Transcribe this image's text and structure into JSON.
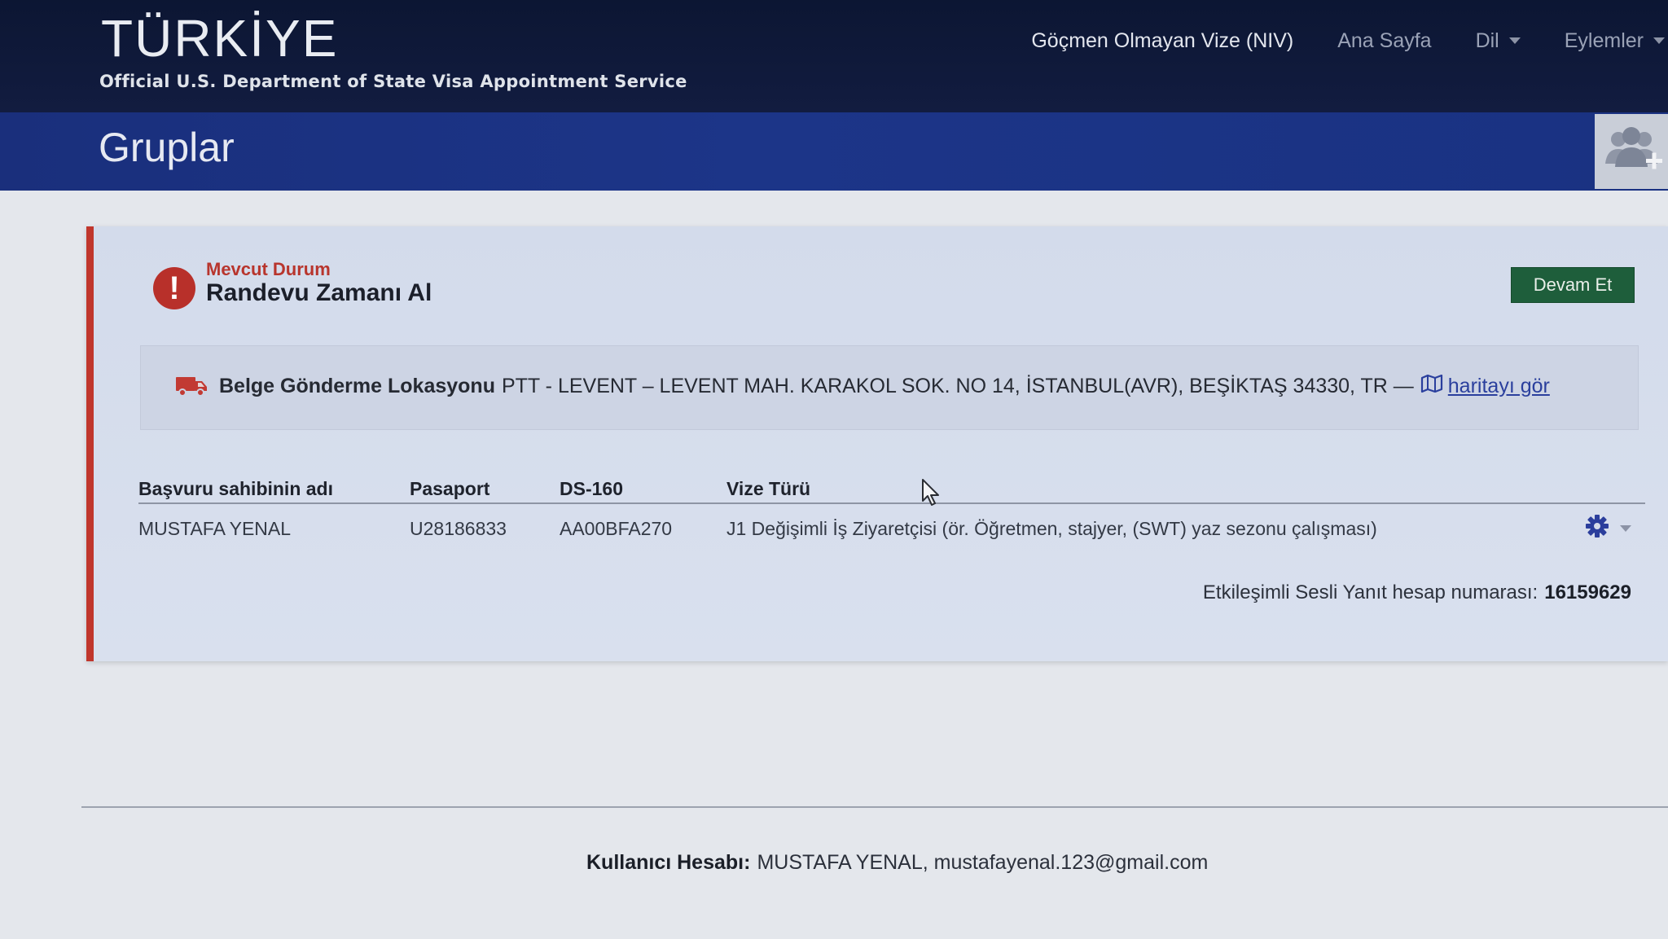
{
  "header": {
    "country": "TÜRKİYE",
    "subtitle": "Official U.S. Department of State Visa Appointment Service",
    "nav": [
      {
        "label": "Göçmen Olmayan Vize (NIV)"
      },
      {
        "label": "Ana Sayfa"
      },
      {
        "label": "Dil"
      },
      {
        "label": "Eylemler"
      }
    ]
  },
  "page": {
    "title": "Gruplar",
    "add_group_icon": "group-add-icon"
  },
  "status": {
    "label": "Mevcut Durum",
    "value": "Randevu Zamanı Al",
    "continue_label": "Devam Et"
  },
  "delivery": {
    "label": "Belge Gönderme Lokasyonu",
    "address": "PTT - LEVENT – LEVENT MAH. KARAKOL SOK. NO 14, İSTANBUL(AVR), BEŞİKTAŞ 34330, TR —",
    "map_link": "haritayı gör"
  },
  "table": {
    "headers": [
      "Başvuru sahibinin adı",
      "Pasaport",
      "DS-160",
      "Vize Türü"
    ],
    "rows": [
      {
        "name": "MUSTAFA YENAL",
        "passport": "U28186833",
        "ds160": "AA00BFA270",
        "visa_type": "J1 Değişimli İş Ziyaretçisi (ör. Öğretmen, stajyer, (SWT) yaz sezonu çalışması)"
      }
    ]
  },
  "ivr": {
    "label": "Etkileşimli Sesli Yanıt hesap numarası:",
    "number": "16159629"
  },
  "footer": {
    "account_label": "Kullanıcı Hesabı:",
    "account_value": "MUSTAFA YENAL, mustafayenal.123@gmail.com"
  },
  "colors": {
    "header_bg": "#0c1633",
    "title_band": "#1c3588",
    "status_red": "#b8302a",
    "continue_green": "#1e5e3b",
    "link_blue": "#2a3f9d"
  }
}
